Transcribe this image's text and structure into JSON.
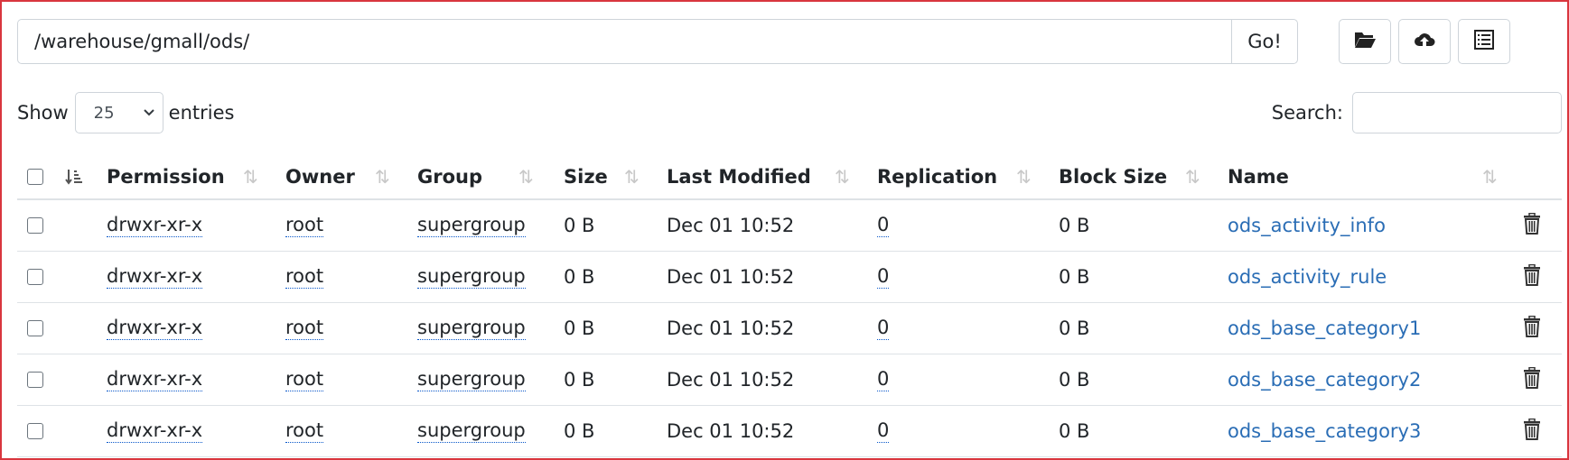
{
  "pathbar": {
    "path_value": "/warehouse/gmall/ods/",
    "go_label": "Go!"
  },
  "toolbar": {
    "icons": [
      "folder-open-icon",
      "cloud-upload-icon",
      "list-alt-icon"
    ]
  },
  "length_menu": {
    "show_label": "Show",
    "selected": "25",
    "entries_label": "entries"
  },
  "search": {
    "label": "Search:",
    "value": ""
  },
  "table": {
    "headers": {
      "permission": "Permission",
      "owner": "Owner",
      "group": "Group",
      "size": "Size",
      "modified": "Last Modified",
      "replication": "Replication",
      "block_size": "Block Size",
      "name": "Name"
    },
    "rows": [
      {
        "permission": "drwxr-xr-x",
        "owner": "root",
        "group": "supergroup",
        "size": "0 B",
        "modified": "Dec 01 10:52",
        "replication": "0",
        "block_size": "0 B",
        "name": "ods_activity_info"
      },
      {
        "permission": "drwxr-xr-x",
        "owner": "root",
        "group": "supergroup",
        "size": "0 B",
        "modified": "Dec 01 10:52",
        "replication": "0",
        "block_size": "0 B",
        "name": "ods_activity_rule"
      },
      {
        "permission": "drwxr-xr-x",
        "owner": "root",
        "group": "supergroup",
        "size": "0 B",
        "modified": "Dec 01 10:52",
        "replication": "0",
        "block_size": "0 B",
        "name": "ods_base_category1"
      },
      {
        "permission": "drwxr-xr-x",
        "owner": "root",
        "group": "supergroup",
        "size": "0 B",
        "modified": "Dec 01 10:52",
        "replication": "0",
        "block_size": "0 B",
        "name": "ods_base_category2"
      },
      {
        "permission": "drwxr-xr-x",
        "owner": "root",
        "group": "supergroup",
        "size": "0 B",
        "modified": "Dec 01 10:52",
        "replication": "0",
        "block_size": "0 B",
        "name": "ods_base_category3"
      }
    ]
  },
  "colors": {
    "link": "#2a6db5",
    "frame": "#d9363e",
    "border": "#dee2e6"
  }
}
